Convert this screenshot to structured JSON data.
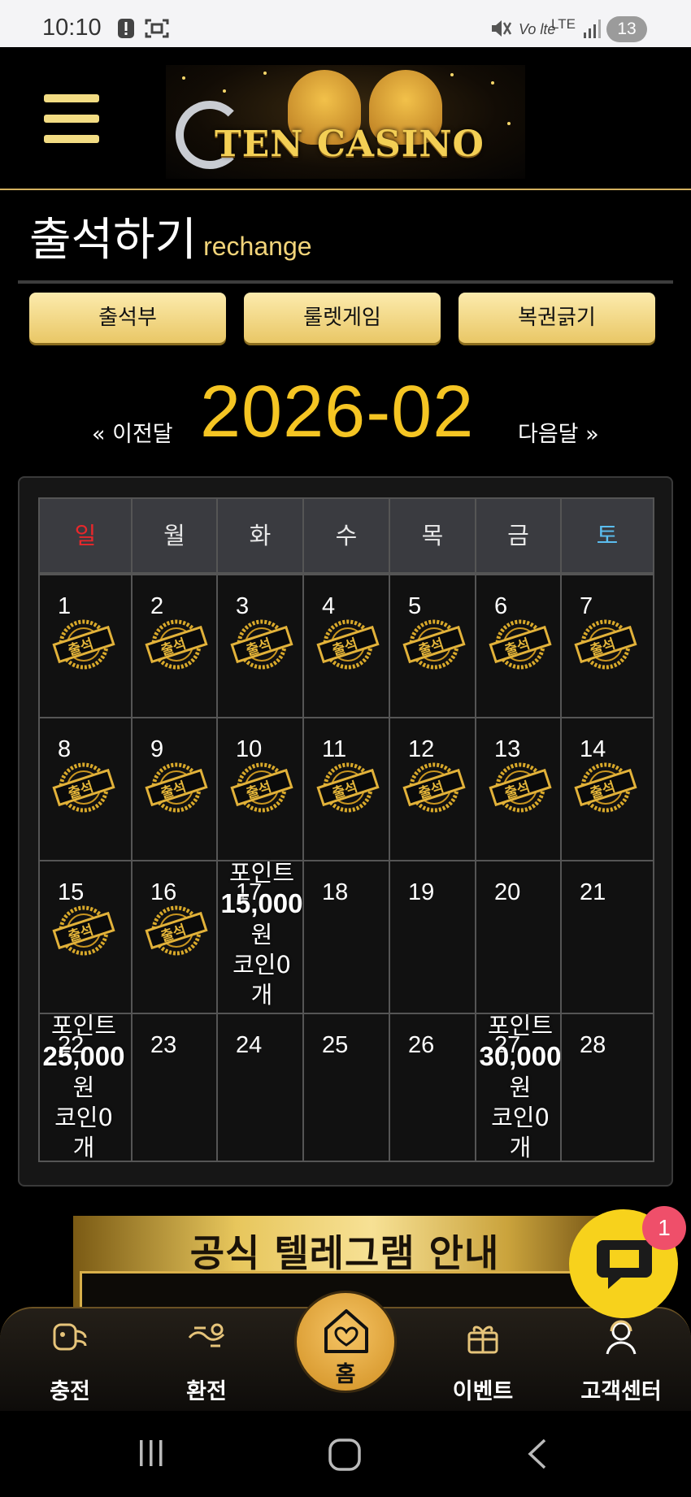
{
  "status_bar": {
    "time": "10:10",
    "network_label": "LTE",
    "volte_label": "Vo lte",
    "battery": "13"
  },
  "header": {
    "logo_text": "TEN CASINO"
  },
  "section": {
    "title": "출석하기",
    "subtitle": "rechange"
  },
  "tabs": [
    {
      "label": "출석부"
    },
    {
      "label": "룰렛게임"
    },
    {
      "label": "복권긁기"
    }
  ],
  "month_nav": {
    "prev": "« 이전달",
    "current": "2026-02",
    "next": "다음달 »"
  },
  "calendar": {
    "weekdays": [
      "일",
      "월",
      "화",
      "수",
      "목",
      "금",
      "토"
    ],
    "weekday_colors": {
      "sunday": "#e8272b",
      "saturday": "#5bbef0"
    },
    "stamp_label": "출석",
    "weeks": [
      [
        {
          "day": "1",
          "stamp": true
        },
        {
          "day": "2",
          "stamp": true
        },
        {
          "day": "3",
          "stamp": true
        },
        {
          "day": "4",
          "stamp": true
        },
        {
          "day": "5",
          "stamp": true
        },
        {
          "day": "6",
          "stamp": true
        },
        {
          "day": "7",
          "stamp": true
        }
      ],
      [
        {
          "day": "8",
          "stamp": true
        },
        {
          "day": "9",
          "stamp": true
        },
        {
          "day": "10",
          "stamp": true
        },
        {
          "day": "11",
          "stamp": true
        },
        {
          "day": "12",
          "stamp": true
        },
        {
          "day": "13",
          "stamp": true
        },
        {
          "day": "14",
          "stamp": true
        }
      ],
      [
        {
          "day": "15",
          "stamp": true
        },
        {
          "day": "16",
          "stamp": true
        },
        {
          "day": "17",
          "stamp": false,
          "reward": [
            "포인트",
            "15,000",
            "원",
            "코인0",
            "개"
          ]
        },
        {
          "day": "18",
          "stamp": false
        },
        {
          "day": "19",
          "stamp": false
        },
        {
          "day": "20",
          "stamp": false
        },
        {
          "day": "21",
          "stamp": false
        }
      ],
      [
        {
          "day": "22",
          "stamp": false,
          "reward": [
            "포인트",
            "25,000",
            "원",
            "코인0",
            "개"
          ]
        },
        {
          "day": "23",
          "stamp": false
        },
        {
          "day": "24",
          "stamp": false
        },
        {
          "day": "25",
          "stamp": false
        },
        {
          "day": "26",
          "stamp": false
        },
        {
          "day": "27",
          "stamp": false,
          "reward": [
            "포인트",
            "30,000",
            "원",
            "코인0",
            "개"
          ]
        },
        {
          "day": "28",
          "stamp": false
        }
      ]
    ]
  },
  "banner": {
    "text": "공식 텔레그램 안내"
  },
  "chat": {
    "badge": "1"
  },
  "bottom_nav": [
    {
      "label": "충전",
      "icon": "deposit-icon"
    },
    {
      "label": "환전",
      "icon": "withdraw-icon"
    },
    {
      "label": "홈",
      "icon": "home-heart-icon"
    },
    {
      "label": "이벤트",
      "icon": "gift-icon"
    },
    {
      "label": "고객센터",
      "icon": "support-icon"
    }
  ],
  "colors": {
    "accent_gold": "#f5c523",
    "button_gold": "#f2d47a",
    "grid_border": "#555555"
  }
}
